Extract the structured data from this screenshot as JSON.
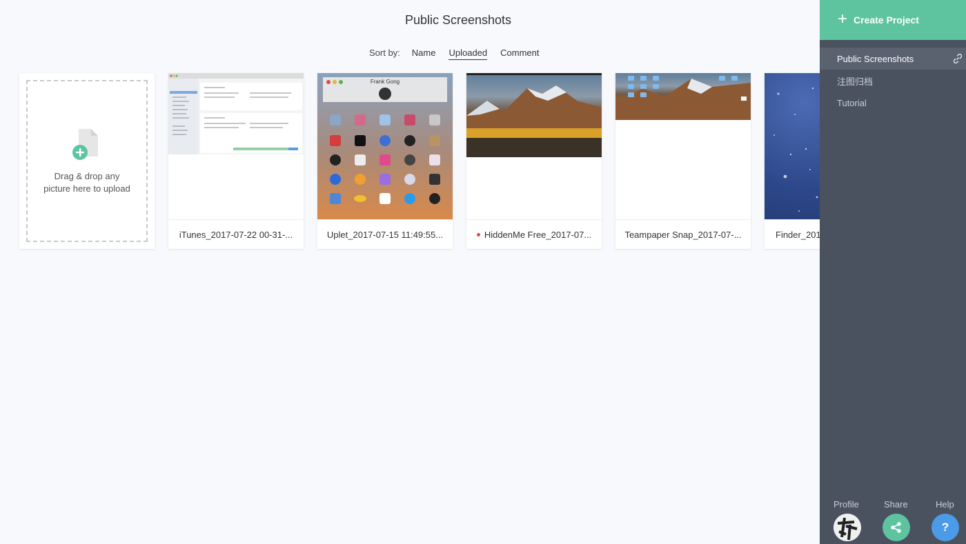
{
  "page": {
    "title": "Public Screenshots"
  },
  "sort": {
    "label": "Sort by:",
    "options": [
      "Name",
      "Uploaded",
      "Comment"
    ],
    "active": "Uploaded"
  },
  "upload": {
    "line1": "Drag & drop any",
    "line2": "picture here to upload"
  },
  "cards": [
    {
      "name": "iTunes_2017-07-22 00-31-..."
    },
    {
      "name": "Uplet_2017-07-15 11:49:55...",
      "thumb_title": "Frank Gong"
    },
    {
      "name": "HiddenMe Free_2017-07...",
      "flag": "red-dot"
    },
    {
      "name": "Teampaper Snap_2017-07-..."
    },
    {
      "name": "Finder_201"
    }
  ],
  "sidebar": {
    "create_label": "Create Project",
    "projects": [
      {
        "label": "Public Screenshots"
      },
      {
        "label": "注图归档"
      },
      {
        "label": "Tutorial"
      }
    ],
    "footer": {
      "profile": "Profile",
      "share": "Share",
      "help": "Help",
      "help_symbol": "?"
    }
  },
  "colors": {
    "accent": "#5ec4a0",
    "sidebar": "#4a5260",
    "help": "#4c9be8"
  }
}
